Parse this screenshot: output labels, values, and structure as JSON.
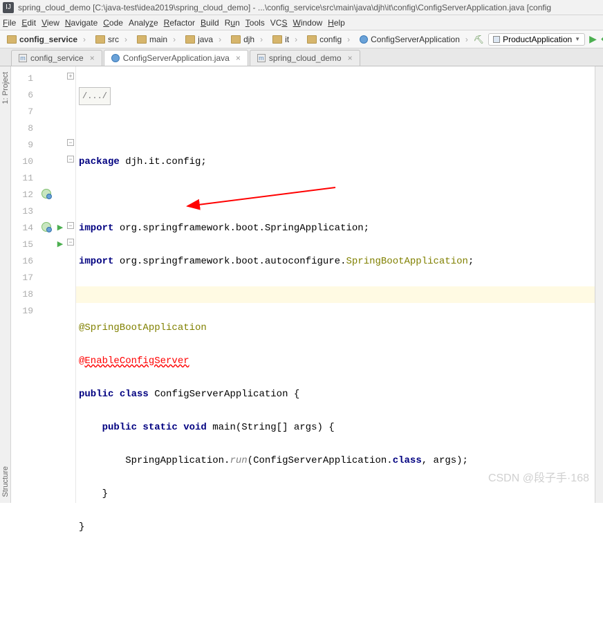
{
  "title": "spring_cloud_demo [C:\\java-test\\idea2019\\spring_cloud_demo] - ...\\config_service\\src\\main\\java\\djh\\it\\config\\ConfigServerApplication.java [config",
  "menu": [
    "File",
    "Edit",
    "View",
    "Navigate",
    "Code",
    "Analyze",
    "Refactor",
    "Build",
    "Run",
    "Tools",
    "VCS",
    "Window",
    "Help"
  ],
  "crumbs": [
    {
      "icon": "fld",
      "bold": true,
      "label": "config_service"
    },
    {
      "icon": "fld",
      "label": "src"
    },
    {
      "icon": "fld",
      "label": "main"
    },
    {
      "icon": "fld",
      "label": "java"
    },
    {
      "icon": "fld",
      "label": "djh"
    },
    {
      "icon": "fld",
      "label": "it"
    },
    {
      "icon": "fld",
      "label": "config"
    },
    {
      "icon": "cls",
      "label": "ConfigServerApplication"
    }
  ],
  "runconfig": "ProductApplication",
  "tabs": [
    {
      "icon": "m",
      "label": "config_service",
      "active": false
    },
    {
      "icon": "c",
      "label": "ConfigServerApplication.java",
      "active": true
    },
    {
      "icon": "m",
      "label": "spring_cloud_demo",
      "active": false
    }
  ],
  "lines": [
    "1",
    "6",
    "7",
    "8",
    "9",
    "10",
    "11",
    "12",
    "13",
    "14",
    "15",
    "16",
    "17",
    "18",
    "19"
  ],
  "code": {
    "folded": "/.../",
    "pkg_kw": "package",
    "pkg": " djh.it.config;",
    "imp_kw": "import",
    "imp1": " org.springframework.boot.SpringApplication;",
    "imp2a": " org.springframework.boot.autoconfigure.",
    "imp2b": "SpringBootApplication",
    "imp2c": ";",
    "ann1": "@SpringBootApplication",
    "ann2a": "@",
    "ann2b": "EnableConfigServer",
    "pub": "public ",
    "clskw": "class ",
    "clsname": "ConfigServerApplication ",
    " ob": "{",
    "sig1": "public static void ",
    "main": "main",
    "sig2": "(String[] args) {",
    "run1": "SpringApplication.",
    "run2": "run",
    "run3": "(ConfigServerApplication.",
    "run4": "class",
    "run5": ", args);",
    "cb": "}"
  },
  "sidetabs": {
    "project": "1: Project",
    "structure": "Structure"
  },
  "watermark": "CSDN @段子手·168"
}
